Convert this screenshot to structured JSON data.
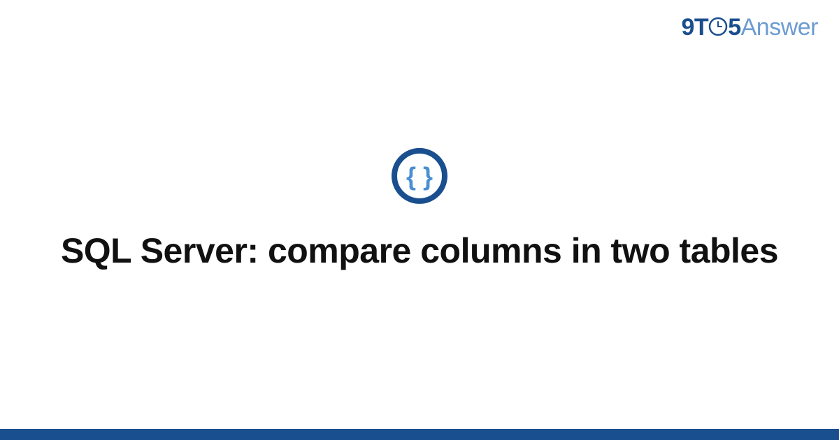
{
  "brand": {
    "part1": "9T",
    "part2": "5",
    "part3": "Answer"
  },
  "icon": {
    "name": "curly-braces-icon"
  },
  "title": "SQL Server: compare columns in two tables",
  "colors": {
    "primary": "#1a4f8f",
    "secondary": "#6b9bd1",
    "iconRing": "#1a4f8f",
    "iconBraces": "#4a8fd1"
  }
}
